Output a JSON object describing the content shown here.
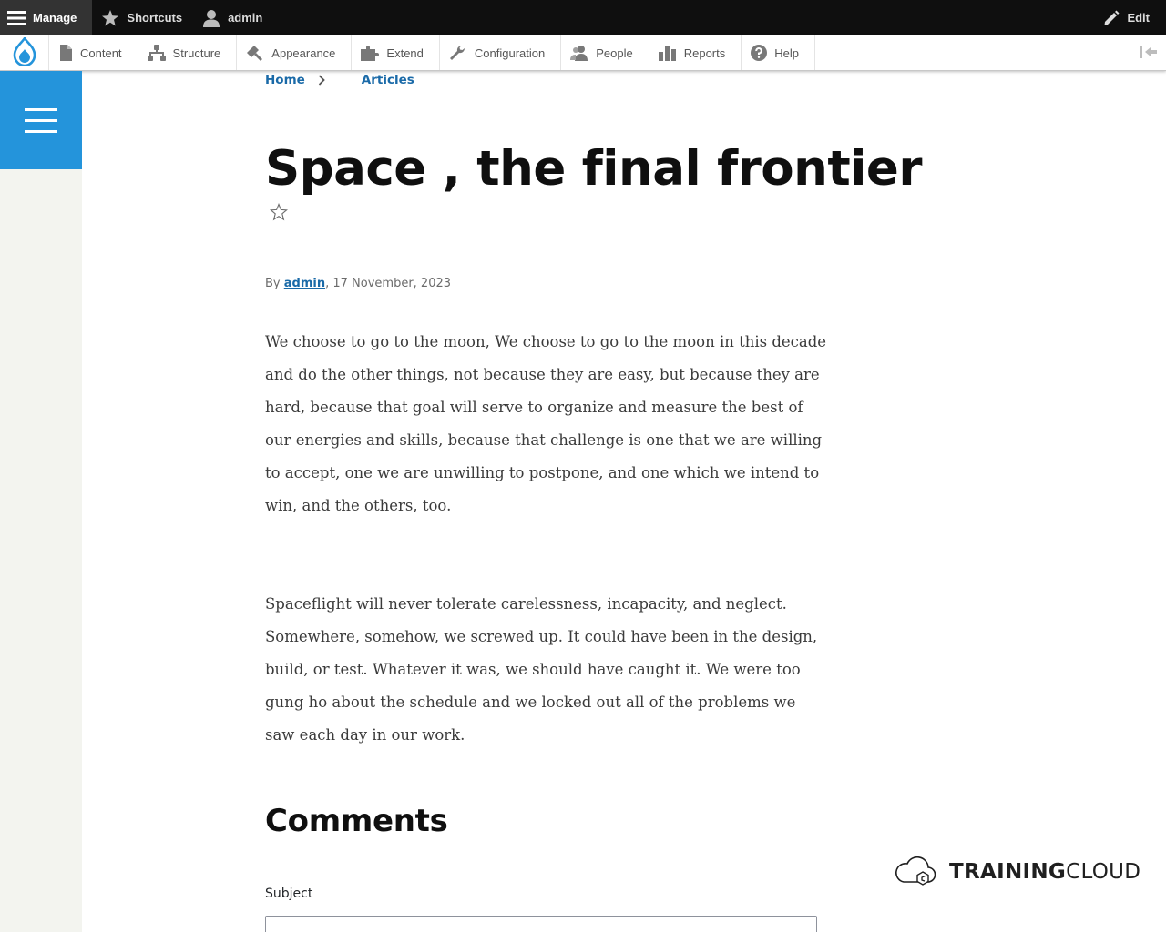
{
  "toolbar": {
    "manage_label": "Manage",
    "shortcuts_label": "Shortcuts",
    "user_label": "admin",
    "edit_label": "Edit"
  },
  "tray": {
    "items": [
      {
        "label": "Content",
        "icon": "file-icon"
      },
      {
        "label": "Structure",
        "icon": "sitemap-icon"
      },
      {
        "label": "Appearance",
        "icon": "paintbrush-icon"
      },
      {
        "label": "Extend",
        "icon": "puzzle-icon"
      },
      {
        "label": "Configuration",
        "icon": "wrench-icon"
      },
      {
        "label": "People",
        "icon": "people-icon"
      },
      {
        "label": "Reports",
        "icon": "bar-chart-icon"
      },
      {
        "label": "Help",
        "icon": "help-icon"
      }
    ]
  },
  "breadcrumb": {
    "home": "Home",
    "articles": "Articles"
  },
  "article": {
    "title": "Space , the final frontier",
    "byline_prefix": "By ",
    "author": "admin",
    "date": ", 17 November, 2023",
    "paragraph_1": "We choose to go to the moon, We choose to go to the moon in this decade and do the other things, not because they are easy, but because they are hard, because that goal will serve to organize and measure the best of our energies and skills, because that challenge is one that we are willing to accept, one we are unwilling to postpone, and one which we intend to win, and the others, too.",
    "paragraph_2": "Spaceflight will never tolerate carelessness, incapacity, and neglect. Somewhere, somehow, we screwed up. It could have been in the design, build, or test. Whatever it was, we should have caught it. We were too gung ho about the schedule and we locked out all of the problems we saw each day in our work."
  },
  "comments": {
    "heading": "Comments",
    "subject_label": "Subject",
    "subject_value": ""
  },
  "watermark": {
    "strong": "TRAINING",
    "light": "CLOUD"
  },
  "colors": {
    "toolbar_dark": "#0f0f0f",
    "hamburger_blue": "#2494db",
    "link_blue": "#1a6aa8",
    "sidebar_bg": "#f3f4ef"
  }
}
